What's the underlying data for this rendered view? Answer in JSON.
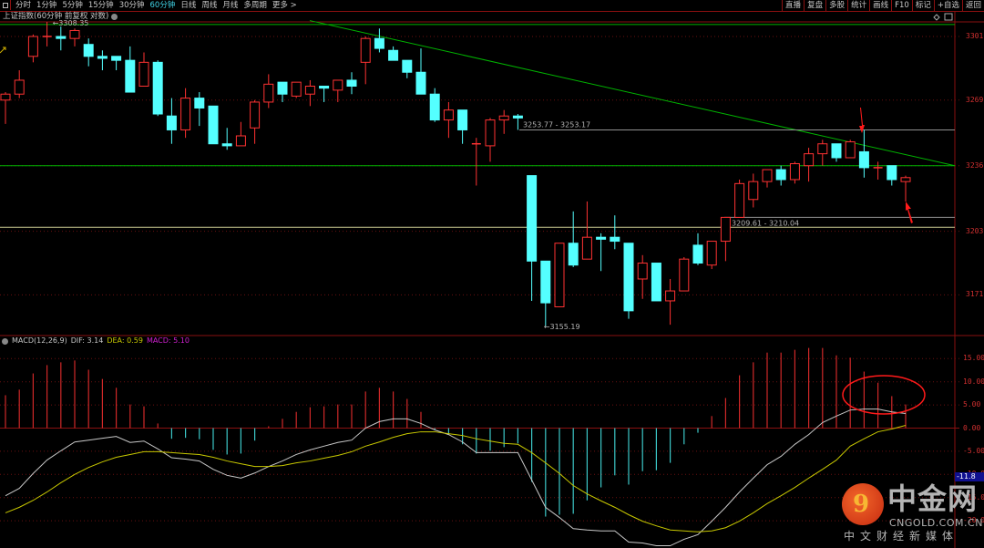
{
  "toolbar": {
    "periods": [
      "分时",
      "1分钟",
      "5分钟",
      "15分钟",
      "30分钟",
      "60分钟",
      "日线",
      "周线",
      "月线",
      "多周期",
      "更多 >"
    ],
    "active_period": "60分钟",
    "right_buttons": [
      "直播",
      "复盘",
      "多股",
      "统计",
      "画线",
      "F10",
      "标记",
      "+自选",
      "返回"
    ]
  },
  "chart_title": "上证指数(60分钟 前复权 对数)",
  "colors": {
    "up": "#ff3232",
    "down": "#54ffff",
    "dif": "#c8c8c8",
    "dea": "#c8c800",
    "macd_label": "#d020d0",
    "grid": "#8a1010",
    "trend": "#00b400"
  },
  "price_axis": {
    "ticks": [
      3301,
      3269,
      3236,
      3203,
      3171
    ]
  },
  "annotations": {
    "high_label": "3308.35",
    "low_label": "3155.19",
    "range_line_1": {
      "label": "3253.77 - 3253.17",
      "price": 3254
    },
    "range_line_2": {
      "label": "3209.61 - 3210.04",
      "price": 3210
    },
    "support_line_price": 3205,
    "horizontal_green_1": 3307,
    "horizontal_green_2": 3236,
    "downtrend_line": {
      "start_price": 3309,
      "end_price": 3236
    }
  },
  "chart_data": {
    "type": "candlestick",
    "title": "上证指数(60分钟 前复权 对数)",
    "ylim": [
      3148,
      3313
    ],
    "candles": [
      [
        3269,
        3273,
        3257,
        3272
      ],
      [
        3272,
        3284,
        3270,
        3279
      ],
      [
        3291,
        3302,
        3288,
        3301
      ],
      [
        3301,
        3308.35,
        3296,
        3301
      ],
      [
        3301,
        3306,
        3294,
        3300
      ],
      [
        3300,
        3305,
        3296,
        3304
      ],
      [
        3297,
        3300,
        3286,
        3291
      ],
      [
        3291,
        3294,
        3284,
        3290
      ],
      [
        3291,
        3291,
        3284,
        3289
      ],
      [
        3289,
        3296,
        3273,
        3273
      ],
      [
        3276,
        3293,
        3276,
        3288
      ],
      [
        3288,
        3289,
        3261,
        3262
      ],
      [
        3261,
        3270,
        3247,
        3254
      ],
      [
        3254,
        3275,
        3250,
        3270
      ],
      [
        3270,
        3273,
        3256,
        3265
      ],
      [
        3266,
        3266,
        3247,
        3247
      ],
      [
        3247,
        3255,
        3244,
        3246
      ],
      [
        3246,
        3258,
        3246,
        3251
      ],
      [
        3255,
        3269,
        3247,
        3268
      ],
      [
        3268,
        3282,
        3265,
        3277
      ],
      [
        3278,
        3278,
        3268,
        3272
      ],
      [
        3271,
        3278,
        3270,
        3278
      ],
      [
        3272,
        3279,
        3266,
        3276
      ],
      [
        3276,
        3276,
        3268,
        3275
      ],
      [
        3274,
        3279,
        3268,
        3279
      ],
      [
        3279,
        3283,
        3272,
        3276
      ],
      [
        3288,
        3301,
        3277,
        3300
      ],
      [
        3300,
        3305,
        3293,
        3295
      ],
      [
        3294,
        3296,
        3289,
        3289
      ],
      [
        3289,
        3289,
        3280,
        3283
      ],
      [
        3283,
        3295,
        3272,
        3272
      ],
      [
        3272,
        3275,
        3258,
        3259
      ],
      [
        3259,
        3268,
        3250,
        3264
      ],
      [
        3264,
        3264,
        3247,
        3254
      ],
      [
        3247,
        3250,
        3226,
        3247
      ],
      [
        3246,
        3260,
        3238,
        3259
      ],
      [
        3259,
        3264,
        3252,
        3261
      ],
      [
        3261,
        3262,
        3254,
        3260
      ],
      [
        3231,
        3231,
        3168,
        3188
      ],
      [
        3188,
        3188,
        3155.19,
        3167
      ],
      [
        3165,
        3197,
        3165,
        3197
      ],
      [
        3197,
        3213,
        3185,
        3186
      ],
      [
        3189,
        3218,
        3189,
        3200
      ],
      [
        3200,
        3202,
        3183,
        3199
      ],
      [
        3200,
        3211,
        3194,
        3198
      ],
      [
        3197,
        3197,
        3159,
        3163
      ],
      [
        3179,
        3191,
        3169,
        3187
      ],
      [
        3187,
        3187,
        3168,
        3168
      ],
      [
        3168,
        3179,
        3156,
        3173
      ],
      [
        3173,
        3190,
        3173,
        3189
      ],
      [
        3196,
        3202,
        3186,
        3187
      ],
      [
        3186,
        3198,
        3184,
        3198
      ],
      [
        3198,
        3210,
        3188,
        3210
      ],
      [
        3210,
        3229,
        3210,
        3227
      ],
      [
        3219,
        3232,
        3215,
        3228
      ],
      [
        3228,
        3234,
        3225,
        3234
      ],
      [
        3234,
        3236,
        3226,
        3229
      ],
      [
        3229,
        3238,
        3227,
        3237
      ],
      [
        3236,
        3245,
        3228,
        3242
      ],
      [
        3242,
        3249,
        3236,
        3247
      ],
      [
        3247,
        3247,
        3238,
        3240
      ],
      [
        3240,
        3249,
        3240,
        3248
      ],
      [
        3243,
        3254,
        3230,
        3235
      ],
      [
        3235,
        3238,
        3229,
        3235
      ],
      [
        3236,
        3236,
        3226,
        3229
      ],
      [
        3228,
        3231,
        3218,
        3230
      ]
    ],
    "candle_fields": [
      "open",
      "high",
      "low",
      "close"
    ],
    "macd": {
      "label": "MACD(12,26,9)",
      "dif_text": "DIF: 3.14",
      "dea_text": "DEA: 0.59",
      "macd_text": "MACD: 5.10",
      "ylim": [
        -25.8,
        19.5
      ],
      "ticks": [
        "15.00",
        "10.00",
        "5.00",
        "0.00",
        "-5.00",
        "-10.00",
        "-15.00",
        "-20.00"
      ],
      "tick_values": [
        15,
        10,
        5,
        0,
        -5,
        -10,
        -15,
        -20
      ],
      "cursor_value": "-11.8",
      "histogram": [
        7.1,
        8.3,
        11.8,
        13.6,
        14.2,
        14.6,
        12.6,
        10.6,
        8.7,
        5.1,
        4.7,
        1.0,
        -2.3,
        -2.1,
        -2.4,
        -4.7,
        -5.7,
        -5.5,
        -2.7,
        0.4,
        2.0,
        3.5,
        4.5,
        4.7,
        5.1,
        5.1,
        7.9,
        8.7,
        7.9,
        6.3,
        3.5,
        -0.3,
        -1.3,
        -3.5,
        -5.5,
        -4.9,
        -4.1,
        -3.3,
        -11.6,
        -19.1,
        -18.7,
        -18.5,
        -15.6,
        -12.8,
        -10.2,
        -12.2,
        -9.3,
        -9.1,
        -7.5,
        -3.5,
        -1.0,
        2.6,
        6.5,
        11.4,
        14.2,
        16.3,
        16.3,
        16.9,
        17.3,
        17.3,
        15.7,
        15.2,
        12.2,
        9.8,
        6.9,
        5.1
      ],
      "dif": [
        -14.6,
        -13.0,
        -9.8,
        -6.9,
        -4.9,
        -3.0,
        -2.6,
        -2.2,
        -1.8,
        -3.1,
        -2.8,
        -4.5,
        -6.4,
        -6.7,
        -7.1,
        -8.9,
        -10.2,
        -10.8,
        -9.7,
        -8.3,
        -7.1,
        -5.7,
        -4.7,
        -3.9,
        -3.1,
        -2.6,
        0,
        1.4,
        2.0,
        2.0,
        1.0,
        -0.4,
        -1.4,
        -3.0,
        -5.3,
        -5.3,
        -5.3,
        -5.3,
        -11.2,
        -17.1,
        -19.3,
        -21.7,
        -22.0,
        -22.2,
        -22.2,
        -24.6,
        -24.8,
        -25.4,
        -25.4,
        -24.0,
        -23.0,
        -20.1,
        -17.1,
        -13.8,
        -10.8,
        -7.9,
        -6.1,
        -3.5,
        -1.4,
        1.2,
        2.6,
        3.9,
        4.1,
        4.1,
        3.5,
        3.14
      ],
      "dea": [
        -18.3,
        -17.1,
        -15.6,
        -13.8,
        -11.8,
        -10.0,
        -8.5,
        -7.3,
        -6.3,
        -5.7,
        -5.1,
        -5.1,
        -5.3,
        -5.5,
        -5.7,
        -6.3,
        -7.1,
        -7.7,
        -8.3,
        -8.3,
        -8.1,
        -7.5,
        -7.1,
        -6.5,
        -5.9,
        -5.1,
        -3.9,
        -3.0,
        -2.0,
        -1.2,
        -0.8,
        -0.8,
        -1.2,
        -1.6,
        -2.3,
        -2.8,
        -3.3,
        -3.5,
        -5.3,
        -7.5,
        -9.8,
        -12.4,
        -14.2,
        -15.7,
        -17.1,
        -18.7,
        -20.1,
        -21.1,
        -22.0,
        -22.2,
        -22.4,
        -22.2,
        -21.5,
        -20.1,
        -18.3,
        -16.3,
        -14.6,
        -12.8,
        -10.8,
        -8.9,
        -6.9,
        -3.9,
        -2.3,
        -0.8,
        -0.2,
        0.59
      ]
    }
  },
  "watermark": {
    "name": "中金网",
    "url": "CNGOLD.COM.CN",
    "slogan": "中文财经新媒体"
  }
}
